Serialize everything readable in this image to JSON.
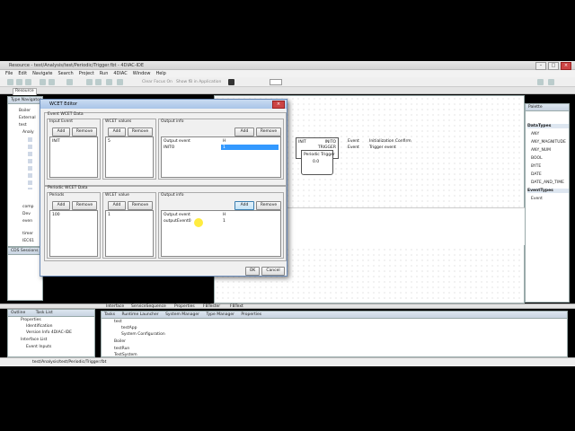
{
  "window": {
    "title": "Resource - test/Analysis/test/Periodic/Trigger.fbt - 4DIAC-IDE"
  },
  "menu": [
    "File",
    "Edit",
    "Navigate",
    "Search",
    "Project",
    "Run",
    "4DIAC",
    "Window",
    "Help"
  ],
  "toolbar": {
    "focus_label": "Clear Focus On",
    "show_label": "Show fB in Application"
  },
  "editor_tab": "Resource",
  "navigator": {
    "title": "Type Navigator",
    "items": [
      "Boiler",
      "External",
      "test",
      "Analy",
      "",
      "",
      "",
      "",
      "",
      "",
      "",
      "",
      "comp",
      "Dev",
      "even",
      "",
      "timer",
      "IEC61"
    ]
  },
  "sessions_label": "CDS Sessions",
  "outline": {
    "tab1": "Outline",
    "tab2": "Task List",
    "items": [
      "Properties",
      "Identification",
      "Version Info 4DIAC-IDE",
      "Interface List",
      "Event Inputs"
    ]
  },
  "bottom_tabs": [
    "Interface",
    "ServiceSequence",
    "Properties",
    "FBTester",
    "FBText"
  ],
  "task_tabs": [
    "Tasks",
    "Runtime Launcher",
    "System Manager",
    "Type Manager",
    "Properties"
  ],
  "task_items": [
    "test",
    "testApp",
    "System Configuration",
    "Boiler",
    "testRun",
    "TestSystem"
  ],
  "fb_block": {
    "input": "INIT",
    "out1": "INITO",
    "out2": "TRIGGER",
    "name": "Periodic Trigger",
    "version": "0.0"
  },
  "event_info": {
    "row1_kind": "Event",
    "row1_desc": "Initialization Confirm",
    "row2_kind": "Event",
    "row2_desc": "Trigger event"
  },
  "palette": {
    "title": "Palette",
    "cat1": "DataTypes",
    "items": [
      "ANY",
      "ANY_MAGNITUDE",
      "ANY_NUM",
      "BOOL",
      "BYTE",
      "DATE",
      "DATE_AND_TIME"
    ],
    "cat2": "EventTypes",
    "item2": "Event"
  },
  "dialog": {
    "title": "WCET Editor",
    "section1": "Event WCET Data",
    "input_event_label": "Input Event",
    "wcet_values_label": "WCET values",
    "output_info_label": "Output info",
    "add": "Add",
    "remove": "Remove",
    "input_events": [
      "INIT"
    ],
    "wcet_values": [
      "5"
    ],
    "output_table_header_event": "Output event",
    "output_table_header_h": "H",
    "output_rows1": [
      {
        "event": "INITO",
        "h": "1"
      }
    ],
    "section2": "Periodic WCET Data",
    "periods_label": "Periods",
    "wcet_value_label": "WCET value",
    "periods": [
      "100"
    ],
    "wcet_value": [
      "1"
    ],
    "output_rows2": [
      {
        "event": "outputEvent0",
        "h": "1"
      }
    ],
    "ok": "OK",
    "cancel": "Cancel"
  },
  "status": {
    "path": "test/Analysis/test/Periodic/Trigger.fbt"
  }
}
